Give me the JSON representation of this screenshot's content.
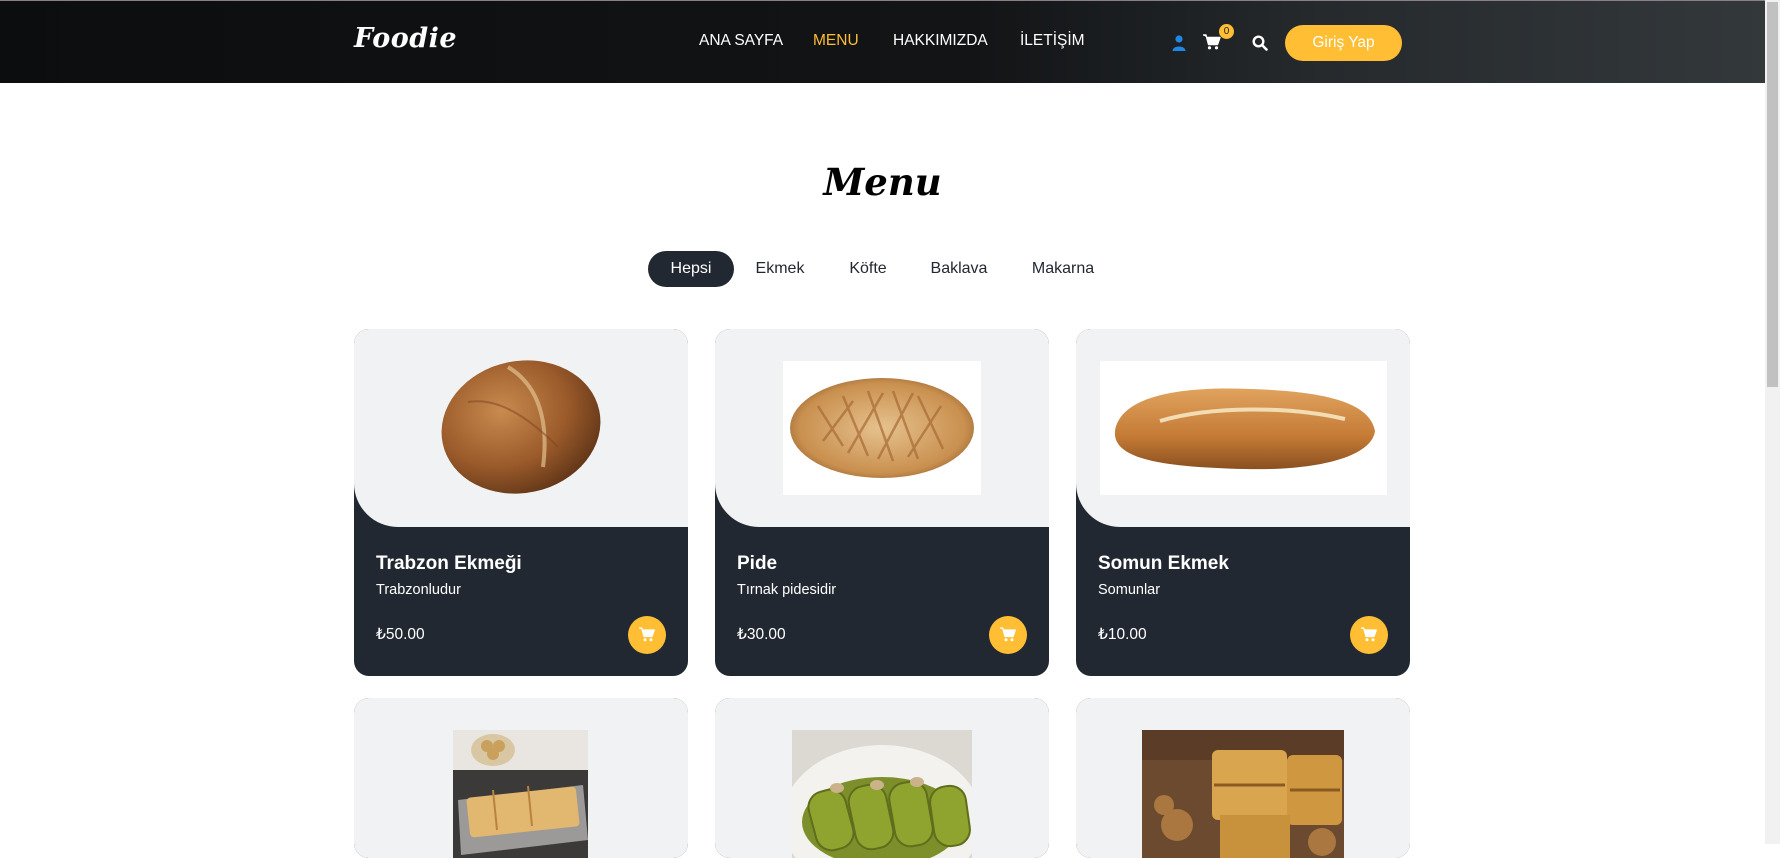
{
  "brand": {
    "logo": "Foodie"
  },
  "nav": {
    "items": [
      {
        "label": "ANA SAYFA",
        "active": false
      },
      {
        "label": "MENU",
        "active": true
      },
      {
        "label": "HAKKIMIZDA",
        "active": false
      },
      {
        "label": "İLETİŞİM",
        "active": false
      }
    ]
  },
  "header_actions": {
    "user_icon": "user-icon",
    "cart_icon": "cart-icon",
    "cart_count": "0",
    "search_icon": "search-icon",
    "login_label": "Giriş Yap"
  },
  "colors": {
    "accent": "#ffbe33",
    "dark": "#222831",
    "user_icon": "#1e88e5"
  },
  "page": {
    "title": "Menu"
  },
  "filters": [
    {
      "label": "Hepsi",
      "active": true
    },
    {
      "label": "Ekmek",
      "active": false
    },
    {
      "label": "Köfte",
      "active": false
    },
    {
      "label": "Baklava",
      "active": false
    },
    {
      "label": "Makarna",
      "active": false
    }
  ],
  "products": [
    {
      "name": "Trabzon Ekmeği",
      "description": "Trabzonludur",
      "price": "₺50.00",
      "image": "round-bread"
    },
    {
      "name": "Pide",
      "description": "Tırnak pidesidir",
      "price": "₺30.00",
      "image": "pide"
    },
    {
      "name": "Somun Ekmek",
      "description": "Somunlar",
      "price": "₺10.00",
      "image": "somun-loaf"
    },
    {
      "name": "",
      "description": "",
      "price": "",
      "image": "baklava-tray"
    },
    {
      "name": "",
      "description": "",
      "price": "",
      "image": "pistachio-sarma"
    },
    {
      "name": "",
      "description": "",
      "price": "",
      "image": "walnut-baklava"
    }
  ]
}
